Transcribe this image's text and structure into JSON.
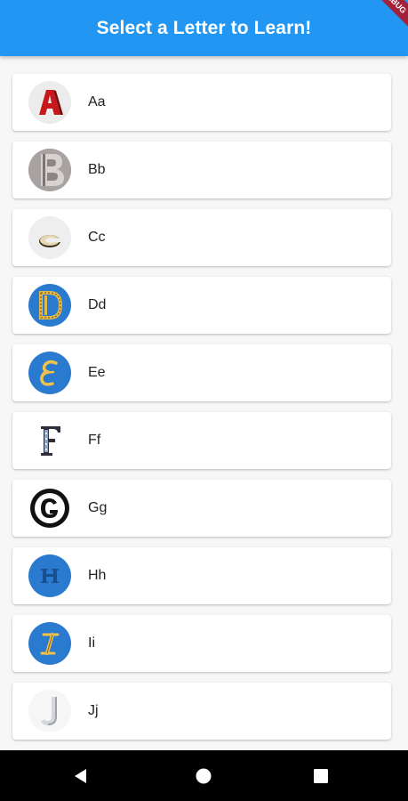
{
  "appbar": {
    "title": "Select a Letter to Learn!"
  },
  "debug_banner": "DEBUG",
  "letters": [
    {
      "label": "Aa",
      "icon": "red-3d-letter-a-icon"
    },
    {
      "label": "Bb",
      "icon": "stone-letter-b-icon"
    },
    {
      "label": "Cc",
      "icon": "tilted-letter-c-icon"
    },
    {
      "label": "Dd",
      "icon": "ornate-gold-letter-d-icon"
    },
    {
      "label": "Ee",
      "icon": "gold-script-letter-e-icon"
    },
    {
      "label": "Ff",
      "icon": "patterned-serif-letter-f-icon"
    },
    {
      "label": "Gg",
      "icon": "black-circle-letter-g-icon"
    },
    {
      "label": "Hh",
      "icon": "blue-letter-h-icon"
    },
    {
      "label": "Ii",
      "icon": "gold-script-letter-i-icon"
    },
    {
      "label": "Jj",
      "icon": "silver-letter-j-icon"
    }
  ],
  "nav": {
    "back": "back-icon",
    "home": "home-icon",
    "recents": "recents-icon"
  }
}
